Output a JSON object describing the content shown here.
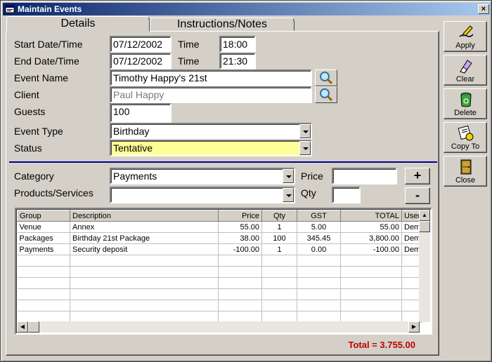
{
  "window": {
    "title": "Maintain Events",
    "close_glyph": "×"
  },
  "tabs": [
    {
      "label": "Details"
    },
    {
      "label": "Instructions/Notes"
    }
  ],
  "form": {
    "start_label": "Start Date/Time",
    "start_date": "07/12/2002",
    "start_time_label": "Time",
    "start_time": "18:00",
    "end_label": "End Date/Time",
    "end_date": "07/12/2002",
    "end_time_label": "Time",
    "end_time": "21:30",
    "event_name_label": "Event Name",
    "event_name": "Timothy Happy's 21st",
    "client_label": "Client",
    "client": "Paul Happy",
    "guests_label": "Guests",
    "guests": "100",
    "event_type_label": "Event Type",
    "event_type": "Birthday",
    "status_label": "Status",
    "status": "Tentative"
  },
  "items": {
    "category_label": "Category",
    "category": "Payments",
    "products_label": "Products/Services",
    "products": "",
    "price_label": "Price",
    "price": "",
    "qty_label": "Qty",
    "qty": "",
    "add_glyph": "+",
    "remove_glyph": "-"
  },
  "grid": {
    "columns": [
      "Group",
      "Description",
      "Price",
      "Qty",
      "GST",
      "TOTAL",
      "User"
    ],
    "rows": [
      [
        "Venue",
        "Annex",
        "55.00",
        "1",
        "5.00",
        "55.00",
        "Demo"
      ],
      [
        "Packages",
        "Birthday 21st Package",
        "38.00",
        "100",
        "345.45",
        "3,800.00",
        "Demo"
      ],
      [
        "Payments",
        "Security deposit",
        "-100.00",
        "1",
        "0.00",
        "-100.00",
        "Demo"
      ]
    ]
  },
  "total_text": "Total = 3.755.00",
  "side_buttons": [
    {
      "label": "Apply",
      "icon": "apply-icon"
    },
    {
      "label": "Clear",
      "icon": "eraser-icon"
    },
    {
      "label": "Delete",
      "icon": "trash-icon"
    },
    {
      "label": "Copy To",
      "icon": "copy-icon"
    },
    {
      "label": "Close",
      "icon": "door-icon"
    }
  ],
  "colors": {
    "highlight": "#ffff99",
    "total": "#c00000",
    "separator": "#000090",
    "titlebar": "#0a246a"
  }
}
